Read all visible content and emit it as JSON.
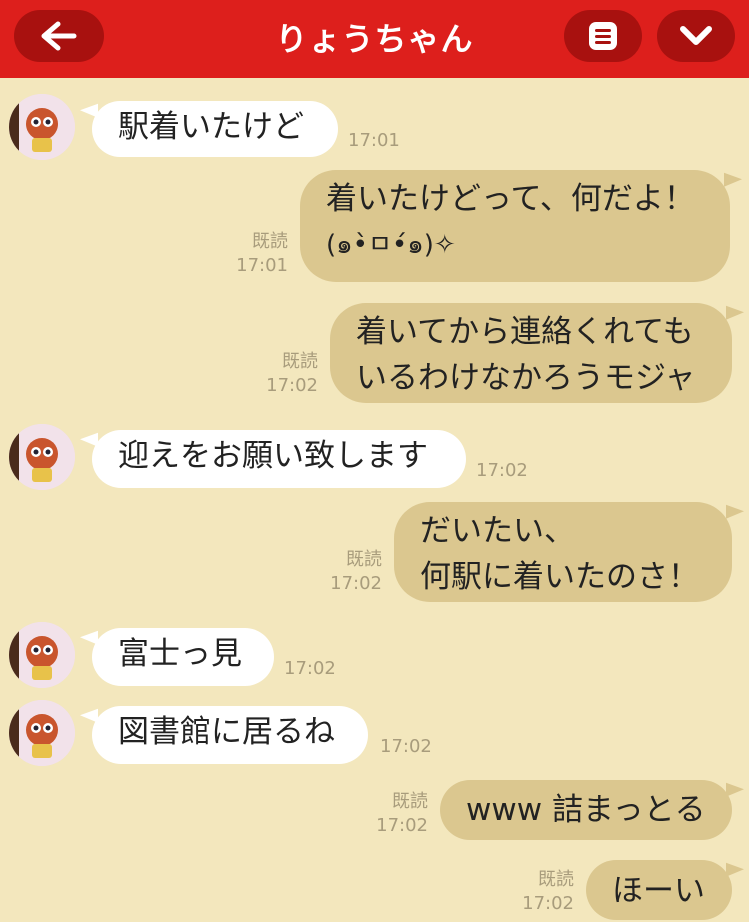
{
  "header": {
    "title": "りょうちゃん",
    "back_icon": "arrow-left-icon",
    "menu_icon": "menu-icon",
    "dropdown_icon": "chevron-down-icon",
    "bg_color": "#dd1f1c"
  },
  "messages": [
    {
      "side": "left",
      "text": "駅着いたけど",
      "time": "17:01"
    },
    {
      "side": "right",
      "lines": [
        "着いたけどって、何だよ！",
        "(๑•̀ㅁ•́๑)✧"
      ],
      "read": "既読",
      "time": "17:01"
    },
    {
      "side": "right",
      "lines": [
        "着いてから連絡くれても",
        "いるわけなかろうモジャ"
      ],
      "read": "既読",
      "time": "17:02"
    },
    {
      "side": "left",
      "text": "迎えをお願い致します",
      "time": "17:02"
    },
    {
      "side": "right",
      "lines": [
        "だいたい、",
        "何駅に着いたのさ！"
      ],
      "read": "既読",
      "time": "17:02"
    },
    {
      "side": "left",
      "text": "富士っ見",
      "time": "17:02"
    },
    {
      "side": "left",
      "text": "図書館に居るね",
      "time": "17:02"
    },
    {
      "side": "right",
      "text": "www 詰まっとる",
      "read": "既読",
      "time": "17:02"
    },
    {
      "side": "right",
      "text": "ほーい",
      "read": "既読",
      "time": "17:02"
    }
  ]
}
